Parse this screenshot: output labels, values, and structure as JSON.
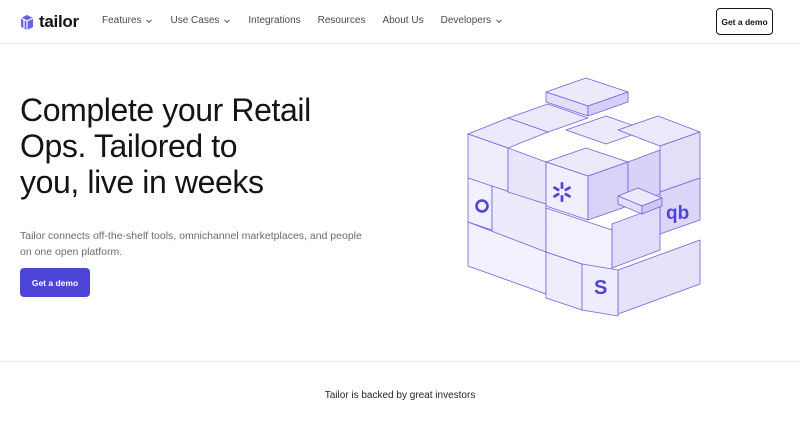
{
  "brand": {
    "name": "tailor",
    "accent": "#4d45d8",
    "cube_fill": "#ece9fb",
    "cube_stroke": "#6d63e0"
  },
  "nav": {
    "items": [
      {
        "label": "Features",
        "dropdown": true
      },
      {
        "label": "Use Cases",
        "dropdown": true
      },
      {
        "label": "Integrations",
        "dropdown": false
      },
      {
        "label": "Resources",
        "dropdown": false
      },
      {
        "label": "About Us",
        "dropdown": false
      },
      {
        "label": "Developers",
        "dropdown": true
      }
    ],
    "cta_label": "Get a demo"
  },
  "hero": {
    "title_lines": [
      "Complete your Retail",
      "Ops. Tailored to",
      "you, live in weeks"
    ],
    "subtitle": "Tailor connects off-the-shelf tools, omnichannel marketplaces, and people on one open platform.",
    "cta_label": "Get a demo",
    "cube_icons": [
      "walmart-spark-icon",
      "quickbooks-icon",
      "shopify-s-icon",
      "circle-logo-icon"
    ],
    "cube_glyphs": {
      "qb": "qb",
      "shopify": "S"
    }
  },
  "investors": {
    "heading": "Tailor is backed by great investors"
  }
}
